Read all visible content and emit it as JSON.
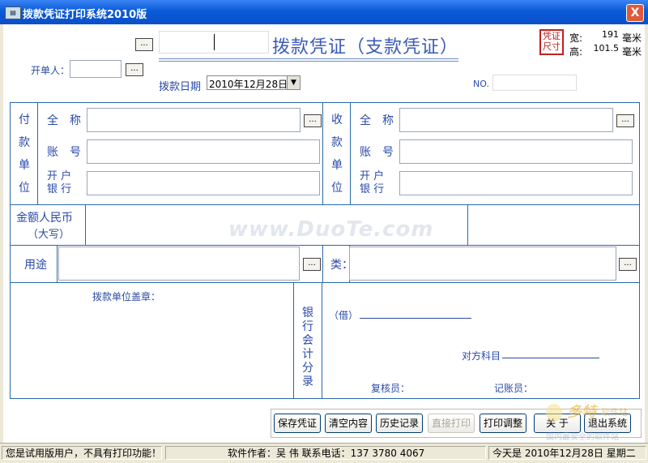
{
  "window": {
    "title": "拨款凭证打印系统2010版",
    "close_glyph": "X",
    "icon": "app-icon"
  },
  "header": {
    "ellipsis": "...",
    "voucher_title": "拨款凭证（支款凭证）",
    "drawer_label": "开单人：",
    "date_label": "拨款日期",
    "date_value": "2010年12月28日",
    "no_label": "NO.",
    "size_stamp_line1": "凭证",
    "size_stamp_line2": "尺寸",
    "width_label": "宽:",
    "width_value": "191",
    "height_label": "高:",
    "height_value": "101.5",
    "unit": "毫米"
  },
  "payer": {
    "unit_chars": [
      "付",
      "款",
      "单",
      "位"
    ],
    "name_label_a": "全",
    "name_label_b": "称",
    "account_label_a": "账",
    "account_label_b": "号",
    "bank_label_a": "开 户",
    "bank_label_b": "银 行"
  },
  "payee": {
    "unit_chars": [
      "收",
      "款",
      "单",
      "位"
    ],
    "name_label_a": "全",
    "name_label_b": "称",
    "account_label_a": "账",
    "account_label_b": "号",
    "bank_label_a": "开 户",
    "bank_label_b": "银 行"
  },
  "amount": {
    "label_line1": "金额人民币",
    "label_line2": "（大写）"
  },
  "purpose": {
    "label": "用途",
    "category_label": "类："
  },
  "bottom": {
    "seal_label": "拨款单位盖章：",
    "bank_entry_chars": [
      "银",
      "行",
      "会",
      "计",
      "分",
      "录"
    ],
    "debit_label": "（借）",
    "counter_account_label": "对方科目",
    "reviewer_label": "复核员：",
    "bookkeeper_label": "记账员："
  },
  "watermark": "www.DuoTe.com",
  "buttons": {
    "save": "保存凭证",
    "clear": "清空内容",
    "history": "历史记录",
    "print_direct": "直接打印",
    "print_adjust": "打印调整",
    "about": "关 于",
    "exit": "退出系统"
  },
  "status": {
    "trial": "您是试用版用户，不具有打印功能！",
    "author": "软件作者：吴 伟   联系电话：137 3780 4067",
    "today": "今天是   2010年12月28日 星期二"
  },
  "corner_logo": {
    "text1": "多特",
    "text2": "软件站",
    "text3": "国内最安全的软件站"
  }
}
